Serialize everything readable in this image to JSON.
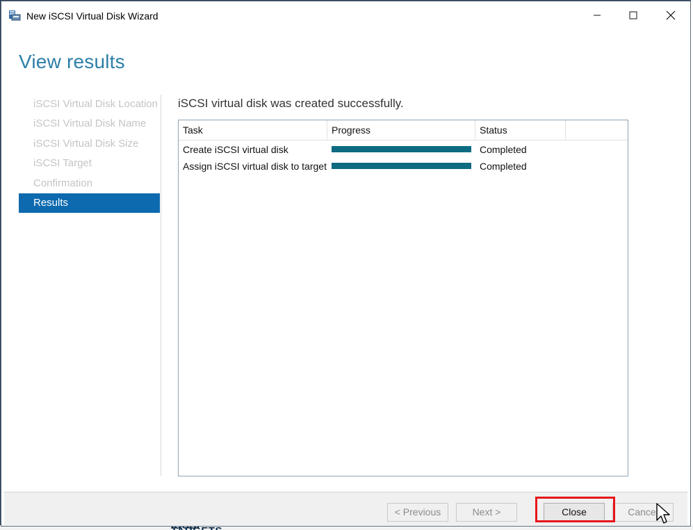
{
  "window": {
    "title": "New iSCSI Virtual Disk Wizard",
    "icon": "server-disk-icon"
  },
  "titlebar_buttons": [
    "minimize",
    "maximize",
    "close"
  ],
  "page": {
    "heading": "View results",
    "message": "iSCSI virtual disk was created successfully."
  },
  "nav": {
    "items": [
      {
        "label": "iSCSI Virtual Disk Location",
        "state": "disabled"
      },
      {
        "label": "iSCSI Virtual Disk Name",
        "state": "disabled"
      },
      {
        "label": "iSCSI Virtual Disk Size",
        "state": "disabled"
      },
      {
        "label": "iSCSI Target",
        "state": "disabled"
      },
      {
        "label": "Confirmation",
        "state": "disabled"
      },
      {
        "label": "Results",
        "state": "active"
      }
    ]
  },
  "results_table": {
    "columns": [
      "Task",
      "Progress",
      "Status"
    ],
    "rows": [
      {
        "task": "Create iSCSI virtual disk",
        "progress": 1.0,
        "status": "Completed"
      },
      {
        "task": "Assign iSCSI virtual disk to target",
        "progress": 1.0,
        "status": "Completed"
      }
    ]
  },
  "footer": {
    "previous_label": "< Previous",
    "next_label": "Next >",
    "close_label": "Close",
    "cancel_label": "Cancel"
  },
  "background": {
    "partial_text": "iSCSI TARGETS"
  },
  "colors": {
    "accent": "#0d6aaf",
    "heading": "#2d7fa8",
    "progress": "#0d6b82",
    "highlight": "#e8141b"
  }
}
